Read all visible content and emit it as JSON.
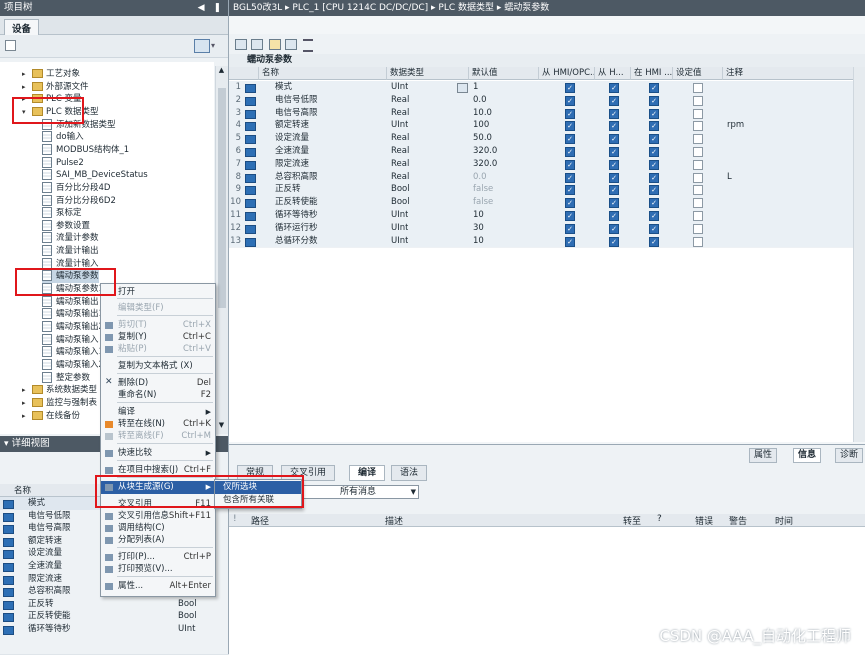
{
  "project_tree": {
    "title": "项目树",
    "tab": "设备",
    "items": [
      {
        "label": "工艺对象",
        "kind": "folder",
        "arrow": "▸"
      },
      {
        "label": "外部源文件",
        "kind": "folder",
        "arrow": "▸"
      },
      {
        "label": "PLC 变量",
        "kind": "folder",
        "arrow": "▸"
      },
      {
        "label": "PLC 数据类型",
        "kind": "folder",
        "arrow": "▾"
      },
      {
        "label": "添加新数据类型",
        "kind": "type"
      },
      {
        "label": "do输入",
        "kind": "type"
      },
      {
        "label": "MODBUS结构体_1",
        "kind": "type"
      },
      {
        "label": "Pulse2",
        "kind": "type"
      },
      {
        "label": "SAI_MB_DeviceStatus",
        "kind": "type"
      },
      {
        "label": "百分比分段4D",
        "kind": "type"
      },
      {
        "label": "百分比分段6D2",
        "kind": "type"
      },
      {
        "label": "泵标定",
        "kind": "type"
      },
      {
        "label": "参数设置",
        "kind": "type"
      },
      {
        "label": "流量计参数",
        "kind": "type"
      },
      {
        "label": "流量计输出",
        "kind": "type"
      },
      {
        "label": "流量计输入",
        "kind": "type"
      },
      {
        "label": "蠕动泵参数",
        "kind": "type"
      },
      {
        "label": "蠕动泵参数1",
        "kind": "type"
      },
      {
        "label": "蠕动泵输出",
        "kind": "type"
      },
      {
        "label": "蠕动泵输出1",
        "kind": "type"
      },
      {
        "label": "蠕动泵输出2",
        "kind": "type"
      },
      {
        "label": "蠕动泵输入",
        "kind": "type"
      },
      {
        "label": "蠕动泵输入1",
        "kind": "type"
      },
      {
        "label": "蠕动泵输入2",
        "kind": "type"
      },
      {
        "label": "整定参数",
        "kind": "type"
      },
      {
        "label": "系统数据类型",
        "kind": "folder",
        "arrow": "▸"
      },
      {
        "label": "监控与强制表",
        "kind": "folder",
        "arrow": "▸"
      },
      {
        "label": "在线备份",
        "kind": "folder",
        "arrow": "▸"
      }
    ]
  },
  "details_view": {
    "title": "详细视图",
    "header": "名称",
    "rows": [
      {
        "name": "模式",
        "type": ""
      },
      {
        "name": "电信号低限",
        "type": ""
      },
      {
        "name": "电信号高限",
        "type": ""
      },
      {
        "name": "额定转速",
        "type": ""
      },
      {
        "name": "设定流量",
        "type": ""
      },
      {
        "name": "全速流量",
        "type": ""
      },
      {
        "name": "限定流速",
        "type": ""
      },
      {
        "name": "总容积高限",
        "type": "Real"
      },
      {
        "name": "正反转",
        "type": "Bool"
      },
      {
        "name": "正反转使能",
        "type": "Bool"
      },
      {
        "name": "循环等待秒",
        "type": "UInt"
      }
    ]
  },
  "breadcrumb": "BGL50改3L  ▸  PLC_1 [CPU 1214C DC/DC/DC]  ▸  PLC 数据类型  ▸  蠕动泵参数",
  "editor": {
    "title": "蠕动泵参数",
    "columns": [
      "名称",
      "数据类型",
      "默认值",
      "从 HMI/OPC...",
      "从 H...",
      "在 HMI ...",
      "设定值",
      "注释"
    ],
    "rows": [
      {
        "n": "1",
        "name": "模式",
        "type": "UInt",
        "default": "1",
        "comment": ""
      },
      {
        "n": "2",
        "name": "电信号低限",
        "type": "Real",
        "default": "0.0",
        "comment": ""
      },
      {
        "n": "3",
        "name": "电信号高限",
        "type": "Real",
        "default": "10.0",
        "comment": ""
      },
      {
        "n": "4",
        "name": "额定转速",
        "type": "UInt",
        "default": "100",
        "comment": "rpm"
      },
      {
        "n": "5",
        "name": "设定流量",
        "type": "Real",
        "default": "50.0",
        "comment": ""
      },
      {
        "n": "6",
        "name": "全速流量",
        "type": "Real",
        "default": "320.0",
        "comment": ""
      },
      {
        "n": "7",
        "name": "限定流速",
        "type": "Real",
        "default": "320.0",
        "comment": ""
      },
      {
        "n": "8",
        "name": "总容积高限",
        "type": "Real",
        "default": "0.0",
        "comment": "L"
      },
      {
        "n": "9",
        "name": "正反转",
        "type": "Bool",
        "default": "false",
        "comment": ""
      },
      {
        "n": "10",
        "name": "正反转使能",
        "type": "Bool",
        "default": "false",
        "comment": ""
      },
      {
        "n": "11",
        "name": "循环等待秒",
        "type": "UInt",
        "default": "10",
        "comment": ""
      },
      {
        "n": "12",
        "name": "循环运行秒",
        "type": "UInt",
        "default": "30",
        "comment": ""
      },
      {
        "n": "13",
        "name": "总循环分数",
        "type": "UInt",
        "default": "10",
        "comment": ""
      }
    ]
  },
  "inspector": {
    "top_tabs": [
      "属性",
      "信息",
      "诊断"
    ],
    "tabs": [
      "常规",
      "交叉引用",
      "编译",
      "语法"
    ],
    "filter_value": "所有消息",
    "columns": [
      "路径",
      "描述",
      "转至",
      "?",
      "错误",
      "警告",
      "时间"
    ]
  },
  "context_menu": {
    "items": [
      {
        "label": "打开",
        "shortcut": ""
      },
      {
        "label": "编辑类型(F)",
        "shortcut": "",
        "disabled": true
      },
      {
        "label": "剪切(T)",
        "shortcut": "Ctrl+X",
        "disabled": true
      },
      {
        "label": "复制(Y)",
        "shortcut": "Ctrl+C"
      },
      {
        "label": "粘贴(P)",
        "shortcut": "Ctrl+V",
        "disabled": true
      },
      {
        "label": "复制为文本格式 (X)",
        "shortcut": ""
      },
      {
        "label": "删除(D)",
        "shortcut": "Del"
      },
      {
        "label": "重命名(N)",
        "shortcut": "F2"
      },
      {
        "label": "编译",
        "shortcut": ""
      },
      {
        "label": "转至在线(N)",
        "shortcut": "Ctrl+K"
      },
      {
        "label": "转至离线(F)",
        "shortcut": "Ctrl+M",
        "disabled": true
      },
      {
        "label": "快速比较",
        "shortcut": ""
      },
      {
        "label": "在项目中搜索(J)",
        "shortcut": "Ctrl+F"
      },
      {
        "label": "从块生成源(G)",
        "shortcut": ""
      },
      {
        "label": "交叉引用",
        "shortcut": "F11"
      },
      {
        "label": "交叉引用信息",
        "shortcut": "Shift+F11"
      },
      {
        "label": "调用结构(C)",
        "shortcut": ""
      },
      {
        "label": "分配列表(A)",
        "shortcut": ""
      },
      {
        "label": "打印(P)...",
        "shortcut": "Ctrl+P"
      },
      {
        "label": "打印预览(V)...",
        "shortcut": ""
      },
      {
        "label": "属性...",
        "shortcut": "Alt+Enter"
      }
    ],
    "submenu": [
      "仅所选块",
      "包含所有关联"
    ]
  },
  "watermark": "CSDN @AAA_自动化工程师",
  "colors": {
    "titlebar": "#4d5964",
    "highlight": "#2c5fa5",
    "redbox": "#e0161b",
    "checkbox": "#2f6db3"
  }
}
